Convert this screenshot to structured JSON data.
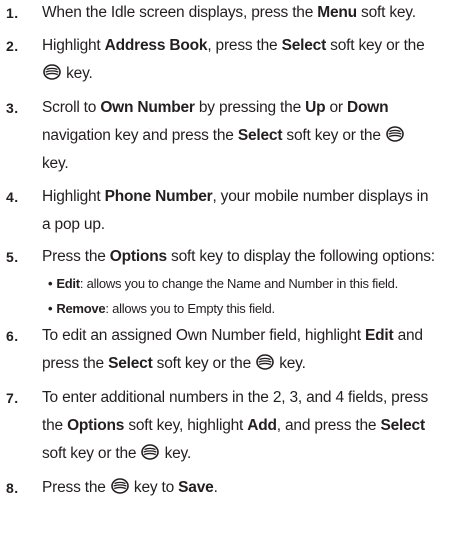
{
  "steps": [
    {
      "number": "1.",
      "lines": [
        [
          {
            "t": "When the Idle screen displays, press the "
          },
          {
            "t": "Menu",
            "b": true
          },
          {
            "t": " soft key."
          }
        ]
      ]
    },
    {
      "number": "2.",
      "lines": [
        [
          {
            "t": "Highlight "
          },
          {
            "t": "Address Book",
            "b": true
          },
          {
            "t": ", press the "
          },
          {
            "t": "Select",
            "b": true
          },
          {
            "t": " soft key or the"
          }
        ],
        [
          {
            "icon": "select-key-icon"
          },
          {
            "t": " key."
          }
        ]
      ]
    },
    {
      "number": "3.",
      "lines": [
        [
          {
            "t": "Scroll to "
          },
          {
            "t": "Own Number",
            "b": true
          },
          {
            "t": " by pressing the "
          },
          {
            "t": "Up",
            "b": true
          },
          {
            "t": " or "
          },
          {
            "t": "Down",
            "b": true
          }
        ],
        [
          {
            "t": "navigation key and press the "
          },
          {
            "t": "Select",
            "b": true
          },
          {
            "t": " soft key or the "
          },
          {
            "icon": "select-key-icon"
          }
        ],
        [
          {
            "t": "key."
          }
        ]
      ]
    },
    {
      "number": "4.",
      "lines": [
        [
          {
            "t": "Highlight "
          },
          {
            "t": "Phone Number",
            "b": true
          },
          {
            "t": ", your mobile number displays in"
          }
        ],
        [
          {
            "t": "a pop up."
          }
        ]
      ]
    },
    {
      "number": "5.",
      "lines": [
        [
          {
            "t": "Press the "
          },
          {
            "t": "Options",
            "b": true
          },
          {
            "t": " soft key to display the following options:"
          }
        ]
      ],
      "bullets": [
        [
          {
            "t": "Edit",
            "b": true
          },
          {
            "t": ": allows you to change the Name and Number in this field."
          }
        ],
        [
          {
            "t": "Remove",
            "b": true
          },
          {
            "t": ": allows you to Empty this field."
          }
        ]
      ]
    },
    {
      "number": "6.",
      "lines": [
        [
          {
            "t": "To edit an assigned Own Number field, highlight "
          },
          {
            "t": "Edit",
            "b": true
          },
          {
            "t": " and"
          }
        ],
        [
          {
            "t": "press the "
          },
          {
            "t": "Select",
            "b": true
          },
          {
            "t": " soft key or the "
          },
          {
            "icon": "select-key-icon"
          },
          {
            "t": " key."
          }
        ]
      ]
    },
    {
      "number": "7.",
      "lines": [
        [
          {
            "t": "To enter additional numbers in the 2, 3, and 4 fields, press"
          }
        ],
        [
          {
            "t": "the "
          },
          {
            "t": "Options",
            "b": true
          },
          {
            "t": " soft key, highlight "
          },
          {
            "t": "Add",
            "b": true
          },
          {
            "t": ", and press the "
          },
          {
            "t": "Select",
            "b": true
          }
        ],
        [
          {
            "t": "soft key or the "
          },
          {
            "icon": "select-key-icon"
          },
          {
            "t": " key."
          }
        ]
      ]
    },
    {
      "number": "8.",
      "lines": [
        [
          {
            "t": "Press the "
          },
          {
            "icon": "select-key-icon"
          },
          {
            "t": " key to "
          },
          {
            "t": "Save",
            "b": true
          },
          {
            "t": "."
          }
        ]
      ]
    }
  ]
}
